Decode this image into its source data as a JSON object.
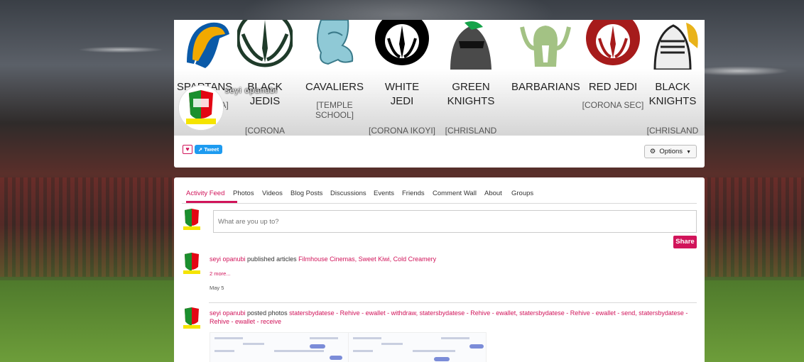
{
  "teams": [
    {
      "name_line1": "SPARTANS",
      "name_line2": "",
      "sub_line": "[AL-HENNA]",
      "logo": "spartan-helmet-icon",
      "colors": [
        "#f2a900",
        "#0a5aa8"
      ]
    },
    {
      "name_line1": "BLACK",
      "name_line2": "JEDIS",
      "sub_line": "[CORONA GBAGADA]",
      "logo": "jedi-order-icon",
      "colors": [
        "#1f3b2a",
        "#ffffff"
      ]
    },
    {
      "name_line1": "CAVALIERS",
      "name_line2": "",
      "sub_line": "[TEMPLE SCHOOL]",
      "logo": "cavalier-horse-icon",
      "colors": [
        "#8fc9d6",
        "#3a7a8a"
      ]
    },
    {
      "name_line1": "WHITE",
      "name_line2": "JEDI",
      "sub_line": "[CORONA IKOYI]",
      "logo": "jedi-order-icon",
      "colors": [
        "#000000",
        "#ffffff"
      ]
    },
    {
      "name_line1": "GREEN",
      "name_line2": "KNIGHTS",
      "sub_line": "[CHRISLAND OPEBI PRIM]",
      "logo": "knight-helmet-icon",
      "colors": [
        "#4a4a4a",
        "#16a34a"
      ]
    },
    {
      "name_line1": "BARBARIANS",
      "name_line2": "",
      "sub_line": "",
      "logo": "barbarian-helmet-icon",
      "colors": [
        "#a3c284",
        "#ffffff"
      ]
    },
    {
      "name_line1": "RED JEDI",
      "name_line2": "",
      "sub_line": "[CORONA SEC]",
      "logo": "jedi-order-icon",
      "colors": [
        "#a61b1b",
        "#ffffff"
      ]
    },
    {
      "name_line1": "BLACK",
      "name_line2": "KNIGHTS",
      "sub_line": "[CHRISLAND OPEBI SEC]",
      "logo": "knight-helmet-icon",
      "colors": [
        "#222222",
        "#e9b31a"
      ]
    }
  ],
  "profile": {
    "name": "seyi opanubi",
    "avatar": "school-crest-avatar"
  },
  "actions": {
    "like_icon": "heart-icon",
    "tweet_label": "Tweet",
    "options_label": "Options"
  },
  "tabs": [
    "Activity Feed",
    "Photos",
    "Videos",
    "Blog Posts",
    "Discussions",
    "Events",
    "Friends",
    "Comment Wall",
    "About",
    "Groups"
  ],
  "composer": {
    "placeholder": "What are you up to?",
    "share_label": "Share"
  },
  "feed": [
    {
      "user": "seyi opanubi",
      "action": " published articles ",
      "links": "Filmhouse Cinemas, Sweet Kiwi, Cold Creamery",
      "more": "2 more...",
      "date": "May 5"
    },
    {
      "user": "seyi opanubi",
      "action": " posted photos ",
      "links": "statersbydatese - Rehive - ewallet - withdraw, statersbydatese - Rehive - ewallet, statersbydatese - Rehive - ewallet - send, statersbydatese - Rehive - ewallet - receive"
    }
  ],
  "colors": {
    "accent": "#d1145a",
    "tweet": "#1d9bf0"
  }
}
